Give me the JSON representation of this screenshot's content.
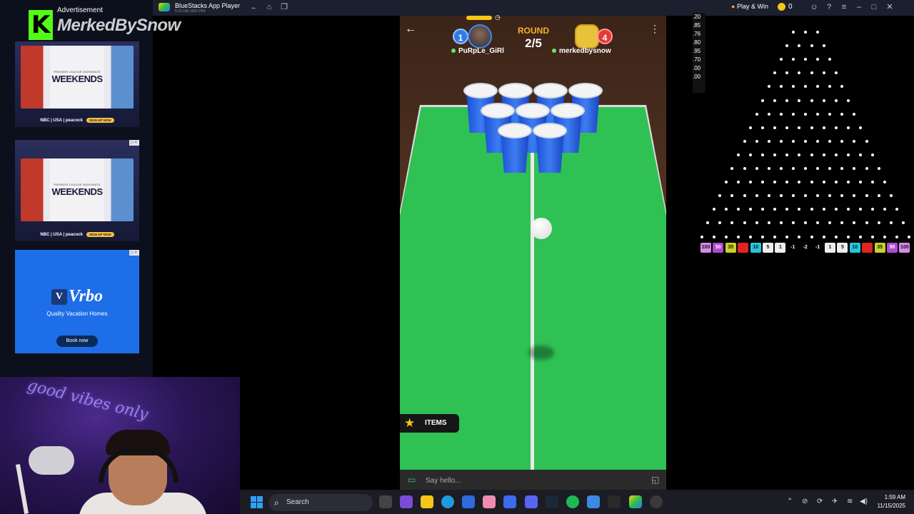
{
  "sidebar": {
    "ad_label": "Advertisement",
    "streamer_name": "MerkedBySnow",
    "ads": [
      {
        "kind": "weekends",
        "headline": "WEEKENDS",
        "sub": "PREMIER LEAGUE MORNINGS",
        "brands": "NBC | USA | peacock",
        "cta": "SIGN UP NOW"
      },
      {
        "kind": "weekends",
        "headline": "WEEKENDS",
        "sub": "PREMIER LEAGUE MORNINGS",
        "brands": "NBC | USA | peacock",
        "cta": "SIGN UP NOW"
      },
      {
        "kind": "vrbo",
        "headline": "Vrbo",
        "sub": "Quality Vacation Homes",
        "cta": "Book now"
      }
    ]
  },
  "webcam": {
    "neon_text": "good vibes only"
  },
  "titlebar": {
    "app_title": "BlueStacks App Player",
    "version": "5.22.140.1002 P64",
    "play_win": "Play & Win",
    "coins": "0"
  },
  "game": {
    "round_label": "ROUND",
    "round_value": "2/5",
    "left_player": {
      "name": "PuRpLe_GiRl",
      "score": "1"
    },
    "right_player": {
      "name": "merkedbysnow",
      "score": "4"
    },
    "items_label": "ITEMS",
    "chat_placeholder": "Say hello..."
  },
  "plinko": {
    "odds": [
      ".20",
      ".85",
      ".76",
      ".80",
      ".95",
      ".70",
      ".00",
      ".00"
    ],
    "buckets": [
      {
        "label": "100",
        "color": "#d58be8"
      },
      {
        "label": "50",
        "color": "#b04bd1"
      },
      {
        "label": "35",
        "color": "#c8d12a"
      },
      {
        "label": "",
        "color": "#e0241f"
      },
      {
        "label": "10",
        "color": "#26c6da"
      },
      {
        "label": "5",
        "color": "#eeeeee"
      },
      {
        "label": "1",
        "color": "#eeeeee"
      },
      {
        "label": "-1",
        "color": "#000000"
      },
      {
        "label": "-2",
        "color": "#000000"
      },
      {
        "label": "-1",
        "color": "#000000"
      },
      {
        "label": "1",
        "color": "#eeeeee"
      },
      {
        "label": "5",
        "color": "#eeeeee"
      },
      {
        "label": "10",
        "color": "#26c6da"
      },
      {
        "label": "",
        "color": "#e0241f"
      },
      {
        "label": "35",
        "color": "#c8d12a"
      },
      {
        "label": "50",
        "color": "#b04bd1"
      },
      {
        "label": "100",
        "color": "#d58be8"
      }
    ]
  },
  "taskbar": {
    "search_label": "Search",
    "time": "1:59 AM",
    "date": "11/15/2025"
  },
  "colors": {
    "table_green": "#2fc154",
    "cup_blue": "#2a63e6",
    "kick_green": "#53fc18",
    "round_gold": "#f5b32b"
  }
}
